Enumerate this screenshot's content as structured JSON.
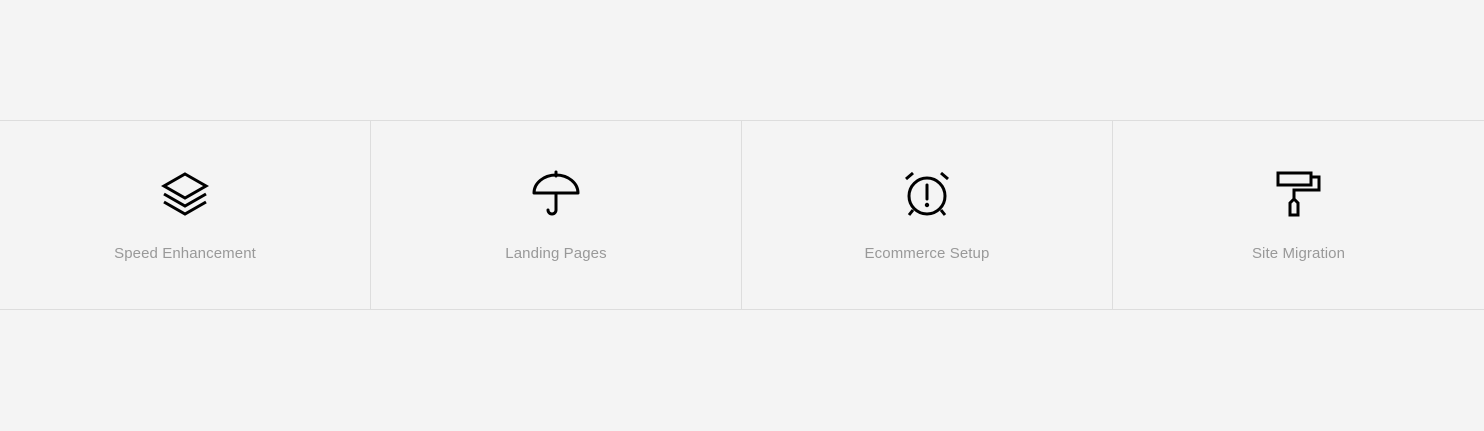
{
  "services": [
    {
      "label": "Speed Enhancement",
      "icon": "layers-icon"
    },
    {
      "label": "Landing Pages",
      "icon": "umbrella-icon"
    },
    {
      "label": "Ecommerce Setup",
      "icon": "alarm-clock-icon"
    },
    {
      "label": "Site Migration",
      "icon": "paint-roller-icon"
    }
  ],
  "colors": {
    "background": "#f4f4f4",
    "divider": "#dddddd",
    "icon": "#000000",
    "label": "#999999"
  }
}
